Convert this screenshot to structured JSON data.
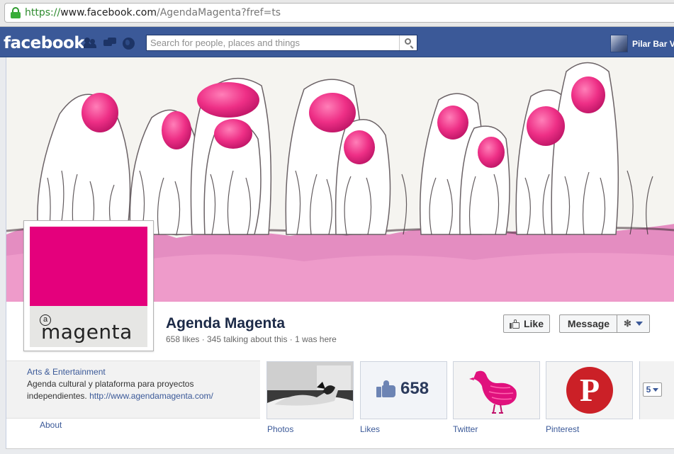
{
  "browser": {
    "url_protocol": "https://",
    "url_host": "www.facebook.com",
    "url_path": "/AgendaMagenta?fref=ts"
  },
  "topbar": {
    "logo": "facebook",
    "search_placeholder": "Search for people, places and things",
    "user_name": "Pilar Bar V"
  },
  "page": {
    "name": "Agenda Magenta",
    "stats": "658 likes · 345 talking about this · 1 was here",
    "profile_logo_text": "magenta",
    "profile_logo_at": "a"
  },
  "actions": {
    "like": "Like",
    "message": "Message"
  },
  "about": {
    "category": "Arts & Entertainment",
    "description": "Agenda cultural y plataforma para proyectos independientes.",
    "link": "http://www.agendamagenta.com/",
    "about_link": "About"
  },
  "apps": [
    {
      "label": "Photos"
    },
    {
      "label": "Likes",
      "count": "658"
    },
    {
      "label": "Twitter"
    },
    {
      "label": "Pinterest",
      "glyph": "P"
    }
  ],
  "more_count": "5",
  "colors": {
    "facebook_blue": "#3b5998",
    "magenta": "#e4007c"
  }
}
